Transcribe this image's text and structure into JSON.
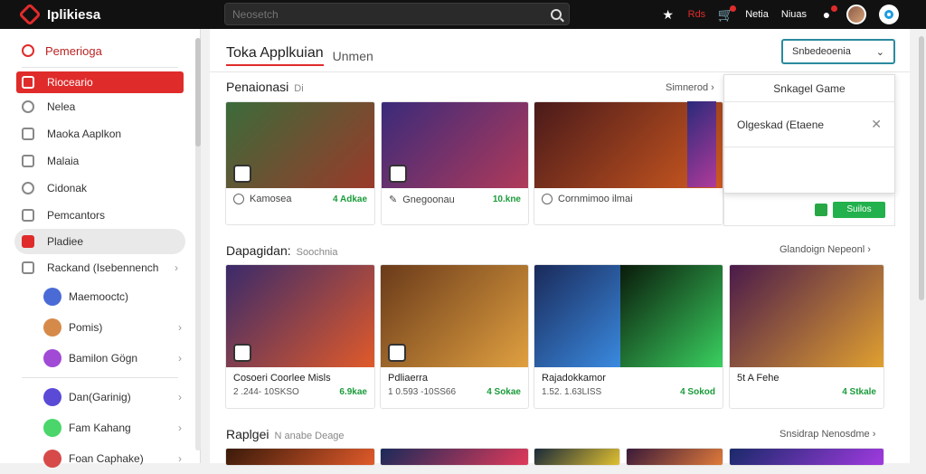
{
  "header": {
    "brand": "Iplikiesa",
    "search_placeholder": "Neosetch",
    "links": [
      "Rds",
      "Netia",
      "Niuas"
    ],
    "icons": [
      "star-icon",
      "cart-icon",
      "bell-icon"
    ]
  },
  "sidebar": {
    "heading": "Pemerioga",
    "items": [
      {
        "label": "Rioceario",
        "icon": "box-icon",
        "active": true
      },
      {
        "label": "Nelea",
        "icon": "search-icon"
      },
      {
        "label": "Maoka Aaplkon",
        "icon": "grid-icon"
      },
      {
        "label": "Malaia",
        "icon": "doc-icon"
      },
      {
        "label": "Cidonak",
        "icon": "chart-icon"
      },
      {
        "label": "Pemcantors",
        "icon": "folder-icon"
      },
      {
        "label": "Pladiee",
        "icon": "play-icon",
        "hover": true
      },
      {
        "label": "Rackand (Isebennench",
        "icon": "tag-icon"
      }
    ],
    "sub_items": [
      {
        "label": "Maemooctc)",
        "color": "#4a6bd6"
      },
      {
        "label": "Pomis)",
        "color": "#d68a4a"
      },
      {
        "label": "Bamilon Gögn",
        "color": "#a04ad6"
      },
      {
        "label": "Dan(Garinig)",
        "color": "#5a4ad6"
      },
      {
        "label": "Fam Kahang",
        "color": "#4ad66a"
      },
      {
        "label": "Foan Caphake)",
        "color": "#d64a4a"
      }
    ]
  },
  "main": {
    "title": "Toka Applkuian",
    "subtitle": "Unmen",
    "sort_label": "Snbedeoenia",
    "section1": {
      "title": "Penaionasi",
      "badge": "Di",
      "see_all": "Simnerod",
      "cards": [
        {
          "label": "Kamosea",
          "value": "4 Adkae",
          "art": [
            "#3b6b3a",
            "#9a3a2a"
          ]
        },
        {
          "label": "Gnegoonau",
          "value": "10.kne",
          "art": [
            "#3a2a7a",
            "#b03a5a"
          ]
        },
        {
          "label": "Cornmimoo ilmai",
          "value": "",
          "art": [
            "#4a1a1a",
            "#d05a20"
          ]
        }
      ]
    },
    "popup": {
      "title": "Snkagel Game",
      "body": "Olgeskad (Etaene",
      "get": "Suilos"
    },
    "section2": {
      "title": "Dapagidan:",
      "badge": "Soochnia",
      "see_all": "Glandoign Nepeonl",
      "cards": [
        {
          "name": "Cosoeri Coorlee Misls",
          "downloads": "2 .244- 10SKSO",
          "price": "6.9kae",
          "art": [
            "#3a2a6a",
            "#e05a2a"
          ]
        },
        {
          "name": "Pdliaerra",
          "downloads": "1 0.593 -10SS66",
          "price": "4 Sokae",
          "art": [
            "#6a3a1a",
            "#e0a040"
          ]
        },
        {
          "name": "Rajadokkamor",
          "downloads": "1.52. 1.63LISS",
          "price": "4 Sokod",
          "art": [
            "#1a2a5a",
            "#3a8ae0"
          ]
        },
        {
          "name": "",
          "downloads": "",
          "price": "",
          "art": [
            "#0a1a0a",
            "#3ad060"
          ]
        },
        {
          "name": "5t A Fehe",
          "downloads": "",
          "price": "4 Stkale",
          "art": [
            "#4a1a4a",
            "#e0a030"
          ]
        }
      ]
    },
    "section3": {
      "title": "Raplgei",
      "badge": "N anabe Deage",
      "see_all": "Snsidrap Nenosdme",
      "arts": [
        [
          "#3a1a0a",
          "#e05a2a"
        ],
        [
          "#1a2a5a",
          "#e03a5a"
        ],
        [
          "#1a2a3a",
          "#e0c030"
        ],
        [
          "#3a1a3a",
          "#e07a3a"
        ],
        [
          "#1a2a6a",
          "#a03ae0"
        ]
      ]
    }
  }
}
